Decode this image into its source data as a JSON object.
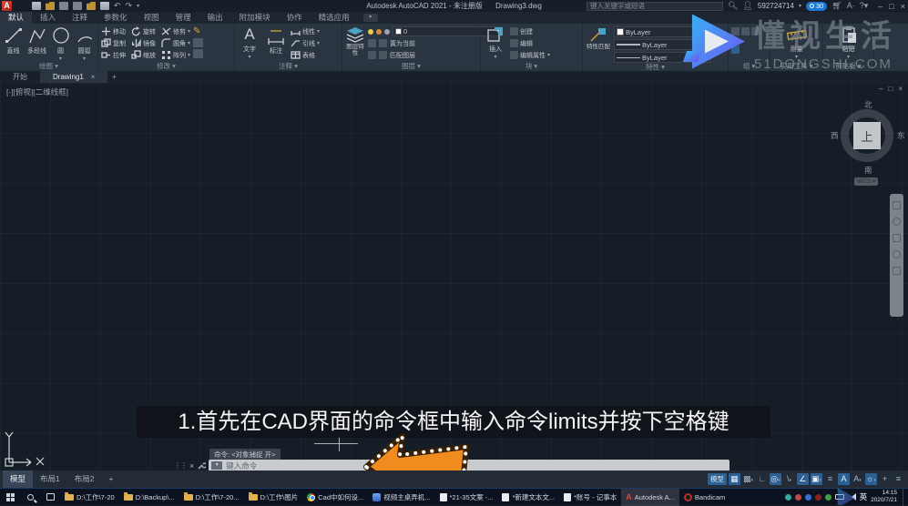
{
  "colors": {
    "accent_blue": "#2f7fd0",
    "arrow_orange": "#f08a1e",
    "trial_badge": "#1d77d3"
  },
  "title_bar": {
    "app_title": "Autodesk AutoCAD 2021 - 未注册版",
    "doc_title": "Drawing3.dwg",
    "search_placeholder": "键入关键字或短语",
    "account_id": "592724714",
    "trial_days": "30"
  },
  "ribbon_tabs": [
    {
      "label": "默认"
    },
    {
      "label": "插入"
    },
    {
      "label": "注释"
    },
    {
      "label": "参数化"
    },
    {
      "label": "视图"
    },
    {
      "label": "管理"
    },
    {
      "label": "输出"
    },
    {
      "label": "附加模块"
    },
    {
      "label": "协作"
    },
    {
      "label": "精选应用"
    }
  ],
  "ribbon": {
    "draw": {
      "label": "绘图",
      "tools": [
        "直线",
        "多段线",
        "圆",
        "圆弧"
      ]
    },
    "modify": {
      "label": "修改",
      "tools": [
        "移动",
        "旋转",
        "修剪",
        "复制",
        "镜像",
        "圆角",
        "拉伸",
        "缩放",
        "阵列"
      ]
    },
    "annotation": {
      "label": "注释",
      "big": [
        "文字",
        "标注"
      ],
      "small": [
        "线性",
        "引线",
        "表格"
      ]
    },
    "layers": {
      "label": "图层",
      "big": "图层特性",
      "dropdown_value": "0",
      "items": [
        "置为当前",
        "匹配图层"
      ]
    },
    "block": {
      "label": "块",
      "big": "插入",
      "items": [
        "创建",
        "编辑",
        "编辑属性"
      ]
    },
    "properties": {
      "label": "特性",
      "big": "特性匹配",
      "values": [
        "ByLayer",
        "ByLayer",
        "ByLayer"
      ]
    },
    "groups": {
      "label": "组"
    },
    "utilities": {
      "label": "实用工具",
      "big": "测量"
    },
    "clipboard": {
      "label": "剪贴板",
      "big": "粘贴"
    }
  },
  "file_tabs": {
    "start": "开始",
    "doc": "Drawing1",
    "close": "×",
    "new": "+"
  },
  "viewport": {
    "label": "[-][俯视][二维线框]",
    "win_min": "–",
    "win_restore": "□",
    "win_close": "×",
    "viewcube": {
      "n": "北",
      "s": "南",
      "w": "西",
      "e": "东",
      "top": "上",
      "wcs": "WCS ▾"
    }
  },
  "caption": "1.首先在CAD界面的命令框中输入命令limits并按下空格键",
  "command_line": {
    "history": "命令: <对象捕捉 开>",
    "placeholder": "键入命令"
  },
  "status_bar": {
    "model_tab": "模型",
    "layout1": "布局1",
    "layout2": "布局2",
    "new_layout": "+",
    "model_badge": "模型",
    "icons": [
      {
        "name": "grid-icon",
        "glyph": "▦"
      },
      {
        "name": "snap-icon",
        "glyph": "▩"
      },
      {
        "name": "ortho-icon",
        "glyph": "∟"
      },
      {
        "name": "polar-icon",
        "glyph": "◎"
      },
      {
        "name": "isodraft-icon",
        "glyph": "\\"
      },
      {
        "name": "otrack-icon",
        "glyph": "∠"
      },
      {
        "name": "osnap-icon",
        "glyph": "▣"
      },
      {
        "name": "lineweight-icon",
        "glyph": "≡"
      },
      {
        "name": "annotation-icon",
        "glyph": "A"
      },
      {
        "name": "annoscale-icon",
        "glyph": "A"
      },
      {
        "name": "workspace-icon",
        "glyph": "☼"
      },
      {
        "name": "crosshair-icon",
        "glyph": "+"
      },
      {
        "name": "cleanscreen-icon",
        "glyph": "≡"
      }
    ]
  },
  "taskbar": {
    "items": [
      "D:\\工作\\7-20",
      "D:\\Backup\\...",
      "D:\\工作\\7-20...",
      "D:\\工作\\图片",
      "Cad中如何设...",
      "视频主桌弄机...",
      "*21-35文案 -...",
      "*新建文本文...",
      "*账号 - 记事本",
      "Autodesk A...",
      "Bandicam"
    ],
    "lang": "英",
    "time": "14:15",
    "date": "2020/7/21"
  },
  "watermark": {
    "name": "懂视生活",
    "site": "51DONGSHI.COM"
  }
}
